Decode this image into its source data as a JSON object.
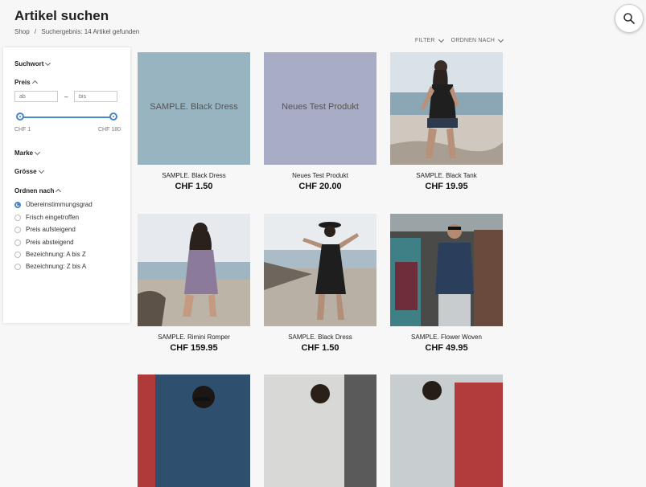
{
  "header": {
    "title": "Artikel suchen",
    "breadcrumb": [
      "Shop",
      "/",
      "Suchergebnis: 14 Artikel gefunden"
    ]
  },
  "toolbar": {
    "filter_label": "FILTER",
    "sort_label": "ORDNEN NACH"
  },
  "sidebar": {
    "search_label": "Suchwort",
    "price_label": "Preis",
    "price_from_placeholder": "ab",
    "price_to_placeholder": "bis",
    "price_min": "CHF 1",
    "price_max": "CHF 180",
    "brand_label": "Marke",
    "size_label": "Grösse",
    "sort_label": "Ordnen nach",
    "sort_options": [
      "Übereinstimmungsgrad",
      "Frisch eingetroffen",
      "Preis aufsteigend",
      "Preis absteigend",
      "Bezeichnung: A bis Z",
      "Bezeichnung: Z bis A"
    ],
    "sort_selected": "Übereinstimmungsgrad"
  },
  "products": [
    {
      "name": "SAMPLE. Black Dress",
      "price": "CHF 1.50",
      "placeholder_text": "SAMPLE. Black Dress"
    },
    {
      "name": "Neues Test Produkt",
      "price": "CHF 20.00",
      "placeholder_text": "Neues Test Produkt"
    },
    {
      "name": "SAMPLE. Black Tank",
      "price": "CHF 19.95"
    },
    {
      "name": "SAMPLE. Rimini Romper",
      "price": "CHF 159.95"
    },
    {
      "name": "SAMPLE. Black Dress",
      "price": "CHF 1.50"
    },
    {
      "name": "SAMPLE. Flower Woven",
      "price": "CHF 49.95"
    }
  ],
  "colors": {
    "accent": "#4a86c6",
    "placeholder_blue": "#98b4c0",
    "placeholder_purple": "#a8acc4"
  }
}
